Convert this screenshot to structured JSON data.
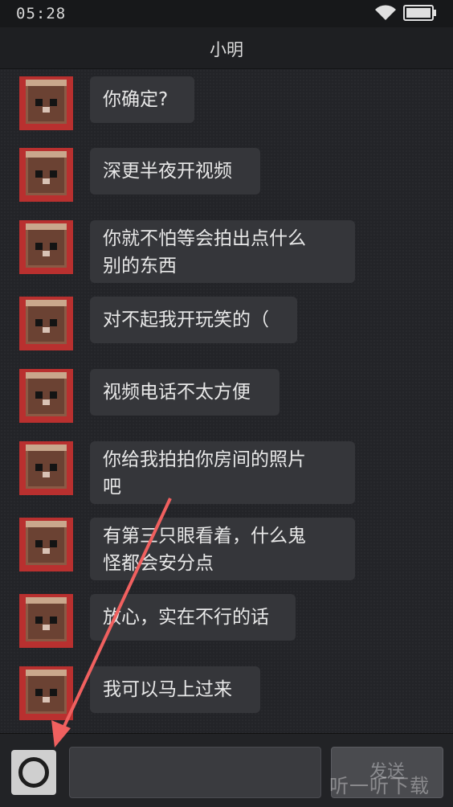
{
  "status_bar": {
    "time": "05:28",
    "icons": [
      "wifi-icon",
      "battery-icon"
    ]
  },
  "header": {
    "title": "小明"
  },
  "messages": [
    {
      "lines": [
        "你确定?"
      ]
    },
    {
      "lines": [
        "深更半夜开视频"
      ]
    },
    {
      "lines": [
        "你就不怕等会拍出点什么",
        "别的东西"
      ]
    },
    {
      "lines": [
        "对不起我开玩笑的（"
      ]
    },
    {
      "lines": [
        "视频电话不太方便"
      ]
    },
    {
      "lines": [
        "你给我拍拍你房间的照片",
        "吧"
      ]
    },
    {
      "lines": [
        "有第三只眼看着，什么鬼",
        "怪都会安分点"
      ]
    },
    {
      "lines": [
        "放心，实在不行的话"
      ]
    },
    {
      "lines": [
        "我可以马上过来"
      ]
    }
  ],
  "composer": {
    "camera_icon": "camera-icon",
    "input_value": "",
    "send_label": "发送"
  },
  "watermark": "听一听下载",
  "colors": {
    "annotation_arrow": "#f0605f",
    "avatar_background": "#b9302f",
    "bubble": "#35363a"
  }
}
